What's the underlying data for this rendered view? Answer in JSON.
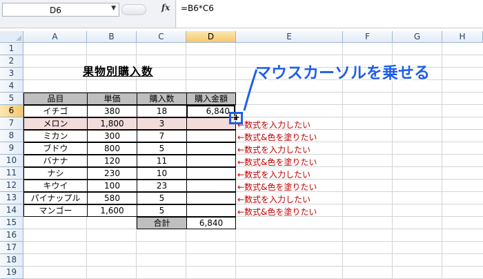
{
  "formula_bar": {
    "name_box": "D6",
    "fx_label": "fx",
    "formula": "=B6*C6"
  },
  "columns": [
    "A",
    "B",
    "C",
    "D",
    "E",
    "F",
    "G",
    "H"
  ],
  "rows": [
    "1",
    "2",
    "3",
    "4",
    "5",
    "6",
    "7",
    "8",
    "9",
    "10",
    "11",
    "12",
    "13",
    "14",
    "15",
    "16",
    "17",
    "18",
    "19"
  ],
  "selected_column": "D",
  "selected_row": "6",
  "title": "果物別購入数",
  "table": {
    "headers": [
      "品目",
      "単価",
      "購入数",
      "購入金額"
    ],
    "rows": [
      {
        "item": "イチゴ",
        "price": "380",
        "qty": "18",
        "amount": "6,840"
      },
      {
        "item": "メロン",
        "price": "1,800",
        "qty": "3",
        "amount": ""
      },
      {
        "item": "ミカン",
        "price": "300",
        "qty": "7",
        "amount": ""
      },
      {
        "item": "ブドウ",
        "price": "800",
        "qty": "5",
        "amount": ""
      },
      {
        "item": "バナナ",
        "price": "120",
        "qty": "11",
        "amount": ""
      },
      {
        "item": "ナシ",
        "price": "230",
        "qty": "10",
        "amount": ""
      },
      {
        "item": "キウイ",
        "price": "100",
        "qty": "23",
        "amount": ""
      },
      {
        "item": "パイナップル",
        "price": "580",
        "qty": "5",
        "amount": ""
      },
      {
        "item": "マンゴー",
        "price": "1,600",
        "qty": "5",
        "amount": ""
      }
    ],
    "total_label": "合計",
    "total_value": "6,840"
  },
  "callout": "マウスカーソルを乗せる",
  "notes": [
    "←数式を入力したい",
    "←数式&色を塗りたい",
    "←数式を入力したい",
    "←数式&色を塗りたい",
    "←数式を入力したい",
    "←数式&色を塗りたい",
    "←数式を入力したい",
    "←数式&色を塗りたい"
  ],
  "colors": {
    "accent_blue": "#1f5ee8",
    "note_red": "#c00000",
    "header_gray": "#bfbfbf",
    "highlight_pink": "#f2dcdb"
  }
}
